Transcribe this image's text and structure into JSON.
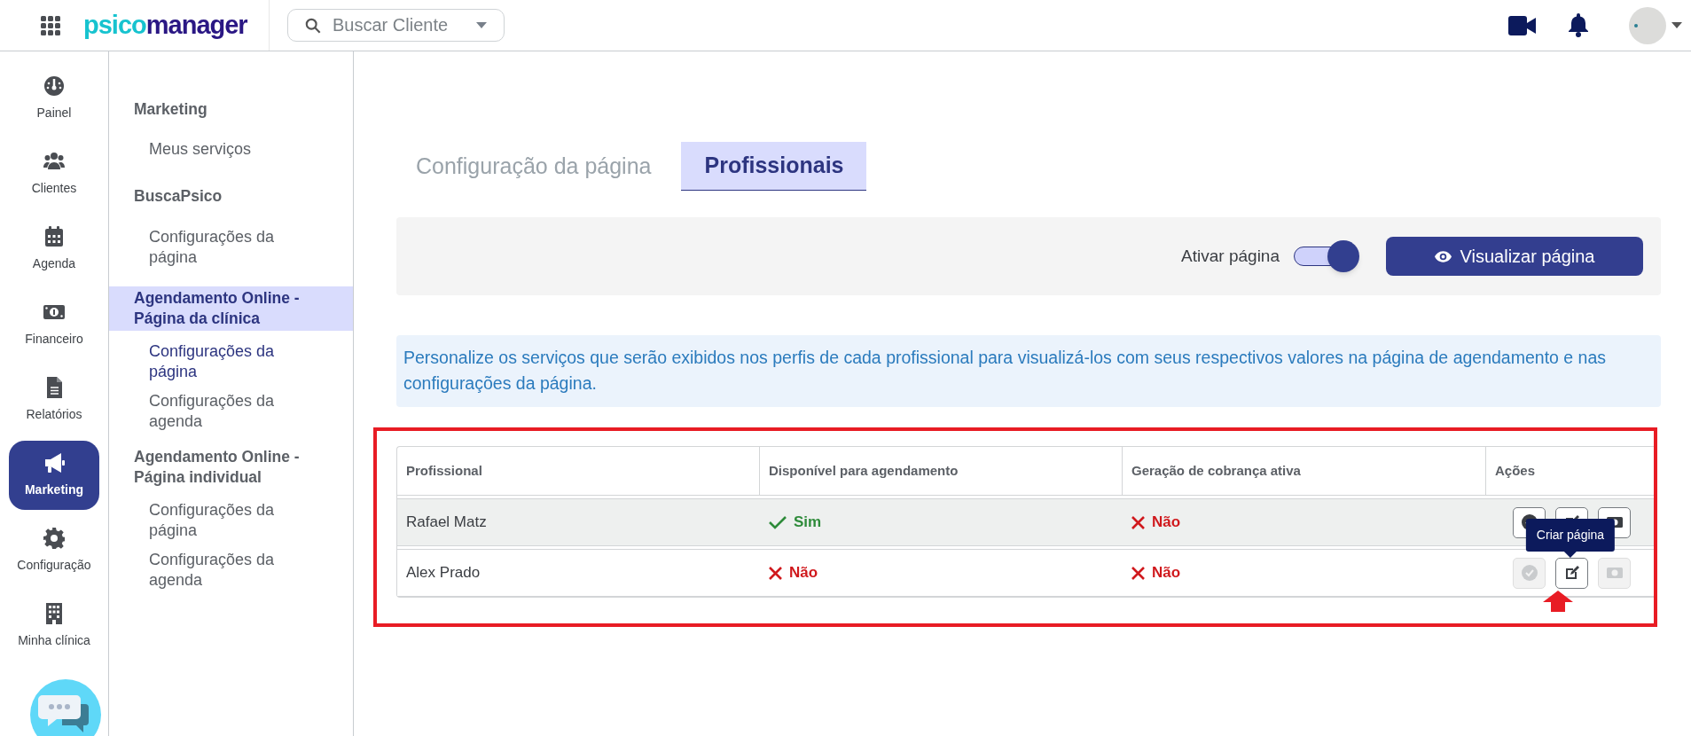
{
  "header": {
    "logo": {
      "prefix": "psico",
      "suffix": "manager"
    },
    "search": {
      "placeholder": "Buscar Cliente"
    }
  },
  "nav_rail": [
    {
      "label": "Painel",
      "selected": false
    },
    {
      "label": "Clientes",
      "selected": false
    },
    {
      "label": "Agenda",
      "selected": false
    },
    {
      "label": "Financeiro",
      "selected": false
    },
    {
      "label": "Relatórios",
      "selected": false
    },
    {
      "label": "Marketing",
      "selected": true
    },
    {
      "label": "Configuração",
      "selected": false
    },
    {
      "label": "Minha clínica",
      "selected": false
    }
  ],
  "submenu": [
    {
      "label": "Marketing",
      "kind": "heading",
      "selected": false
    },
    {
      "label": "Meus serviços",
      "kind": "item",
      "selected": false
    },
    {
      "label": "BuscaPsico",
      "kind": "heading",
      "selected": false
    },
    {
      "label": "Configurações da página",
      "kind": "item",
      "selected": false
    },
    {
      "label": "Agendamento Online - Página da clínica",
      "kind": "heading",
      "selected": true
    },
    {
      "label": "Configurações da página",
      "kind": "item",
      "selected": true
    },
    {
      "label": "Configurações da agenda",
      "kind": "item",
      "selected": false
    },
    {
      "label": "Agendamento Online - Página individual",
      "kind": "heading",
      "selected": false
    },
    {
      "label": "Configurações da página",
      "kind": "item",
      "selected": false
    },
    {
      "label": "Configurações da agenda",
      "kind": "item",
      "selected": false
    }
  ],
  "tabs": [
    {
      "label": "Configuração da página",
      "selected": false
    },
    {
      "label": "Profissionais",
      "selected": true
    }
  ],
  "toolbar": {
    "toggle": {
      "label": "Ativar página",
      "on": true
    },
    "button": "Visualizar página"
  },
  "info": "Personalize os serviços que serão exibidos nos perfis de cada profissional para visualizá-los com seus respectivos valores na página de agendamento e nas configurações da página.",
  "table": {
    "columns": [
      "Profissional",
      "Disponível para agendamento",
      "Geração de cobrança ativa",
      "Ações"
    ],
    "rows": [
      {
        "name": "Rafael Matz",
        "selected": true,
        "available": {
          "value": true,
          "text": "Sim"
        },
        "billing": {
          "value": false,
          "text": "Não"
        },
        "actions": [
          {
            "kind": "approve",
            "disabled": false
          },
          {
            "kind": "edit",
            "disabled": false
          },
          {
            "kind": "money",
            "disabled": false
          }
        ]
      },
      {
        "name": "Alex Prado",
        "selected": false,
        "available": {
          "value": false,
          "text": "Não"
        },
        "billing": {
          "value": false,
          "text": "Não"
        },
        "actions": [
          {
            "kind": "approve",
            "disabled": true
          },
          {
            "kind": "edit",
            "disabled": false
          },
          {
            "kind": "money",
            "disabled": true
          }
        ]
      }
    ]
  },
  "tooltip": "Criar página"
}
